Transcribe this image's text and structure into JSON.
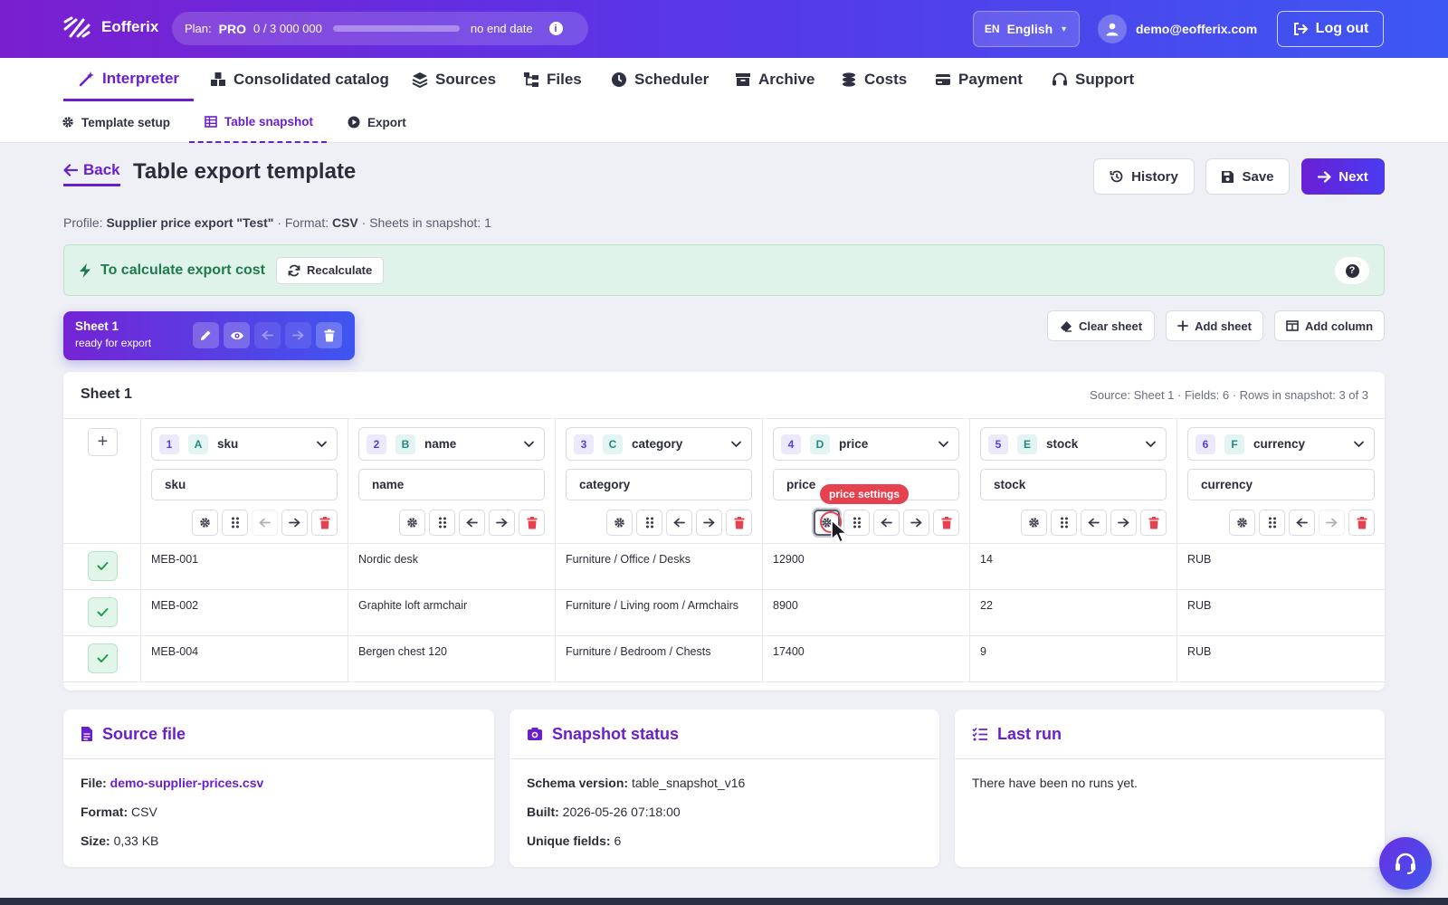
{
  "header": {
    "logo_text": "Eofferix",
    "plan_label": "Plan:",
    "plan_name": "PRO",
    "plan_usage": "0 / 3 000 000",
    "plan_usage_fraction": 0,
    "plan_expiry": "no end date",
    "lang_code": "EN",
    "lang_name": "English",
    "user_email": "demo@eofferix.com",
    "logout_label": "Log out"
  },
  "main_nav": [
    {
      "label": "Interpreter",
      "icon": "magic-wand-icon",
      "active": true
    },
    {
      "label": "Consolidated catalog",
      "icon": "boxes-icon",
      "active": false
    },
    {
      "label": "Sources",
      "icon": "layers-icon",
      "active": false
    },
    {
      "label": "Files",
      "icon": "folder-tree-icon",
      "active": false
    },
    {
      "label": "Scheduler",
      "icon": "clock-icon",
      "active": false
    },
    {
      "label": "Archive",
      "icon": "archive-box-icon",
      "active": false
    },
    {
      "label": "Costs",
      "icon": "coins-icon",
      "active": false
    },
    {
      "label": "Payment",
      "icon": "credit-card-icon",
      "active": false
    },
    {
      "label": "Support",
      "icon": "headset-icon",
      "active": false
    }
  ],
  "sub_nav": [
    {
      "label": "Template setup",
      "icon": "gear-icon",
      "active": false
    },
    {
      "label": "Table snapshot",
      "icon": "table-icon",
      "active": true
    },
    {
      "label": "Export",
      "icon": "play-circle-icon",
      "active": false
    }
  ],
  "page": {
    "back_label": "Back",
    "title": "Table export template",
    "history_label": "History",
    "save_label": "Save",
    "next_label": "Next",
    "profile_prefix": "Profile:",
    "profile_name": "Supplier price export \"Test\"",
    "format_prefix": "· Format:",
    "format_value": "CSV",
    "sheets_text": "· Sheets in snapshot: 1"
  },
  "banner": {
    "text": "To calculate export cost",
    "button_label": "Recalculate"
  },
  "sheet_tab": {
    "name": "Sheet 1",
    "status": "ready for export"
  },
  "sheet_actions": {
    "clear_label": "Clear sheet",
    "add_sheet_label": "Add sheet",
    "add_column_label": "Add column"
  },
  "table": {
    "title": "Sheet 1",
    "meta": "Source: Sheet 1 · Fields: 6 · Rows in snapshot: 3 of 3",
    "add_column_symbol": "+",
    "columns": [
      {
        "num": "1",
        "letter": "A",
        "field": "sku",
        "name": "sku"
      },
      {
        "num": "2",
        "letter": "B",
        "field": "name",
        "name": "name"
      },
      {
        "num": "3",
        "letter": "C",
        "field": "category",
        "name": "category"
      },
      {
        "num": "4",
        "letter": "D",
        "field": "price",
        "name": "price"
      },
      {
        "num": "5",
        "letter": "E",
        "field": "stock",
        "name": "stock"
      },
      {
        "num": "6",
        "letter": "F",
        "field": "currency",
        "name": "currency"
      }
    ],
    "rows": [
      [
        "MEB-001",
        "Nordic desk",
        "Furniture / Office / Desks",
        "12900",
        "14",
        "RUB"
      ],
      [
        "MEB-002",
        "Graphite loft armchair",
        "Furniture / Living room / Armchairs",
        "8900",
        "22",
        "RUB"
      ],
      [
        "MEB-004",
        "Bergen chest 120",
        "Furniture / Bedroom / Chests",
        "17400",
        "9",
        "RUB"
      ]
    ],
    "tooltip": "price settings"
  },
  "source_file": {
    "title": "Source file",
    "file_label": "File:",
    "file_value": "demo-supplier-prices.csv",
    "format_label": "Format:",
    "format_value": "CSV",
    "size_label": "Size:",
    "size_value": "0,33 KB"
  },
  "snapshot_status": {
    "title": "Snapshot status",
    "schema_label": "Schema version:",
    "schema_value": "table_snapshot_v16",
    "built_label": "Built:",
    "built_value": "2026-05-26 07:18:00",
    "unique_label": "Unique fields:",
    "unique_value": "6"
  },
  "last_run": {
    "title": "Last run",
    "text": "There have been no runs yet."
  },
  "colors": {
    "accent": "#6a1fcf",
    "danger": "#e6414f",
    "success": "#1f7a4d"
  }
}
